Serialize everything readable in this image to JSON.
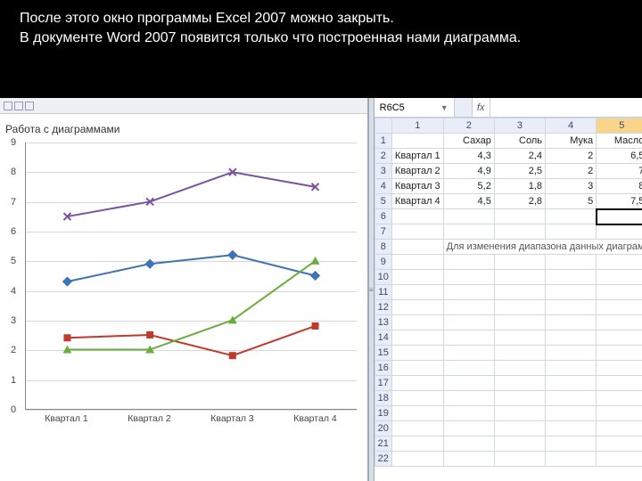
{
  "caption": {
    "line1": "После этого окно программы Excel 2007 можно закрыть.",
    "line2": "В документе Word 2007 появится только что построенная нами диаграмма."
  },
  "word": {
    "chart_tools_label": "Работа с диаграммами"
  },
  "excel": {
    "namebox": "R6C5",
    "fx_label": "fx",
    "columns": [
      "1",
      "2",
      "3",
      "4",
      "5"
    ],
    "selected_col_index": 4,
    "headers_row": [
      "",
      "Сахар",
      "Соль",
      "Мука",
      "Масло"
    ],
    "data_rows": [
      [
        "Квартал 1",
        "4,3",
        "2,4",
        "2",
        "6,5"
      ],
      [
        "Квартал 2",
        "4,9",
        "2,5",
        "2",
        "7"
      ],
      [
        "Квартал 3",
        "5,2",
        "1,8",
        "3",
        "8"
      ],
      [
        "Квартал 4",
        "4,5",
        "2,8",
        "5",
        "7,5"
      ]
    ],
    "active_cell": {
      "r": 6,
      "c": 5
    },
    "hint_text": "Для изменения диапазона данных диаграм",
    "blank_rows_start": 6,
    "blank_rows_end": 22
  },
  "chart_data": {
    "type": "line",
    "categories": [
      "Квартал 1",
      "Квартал 2",
      "Квартал 3",
      "Квартал 4"
    ],
    "series": [
      {
        "name": "Сахар",
        "color": "#3f73b8",
        "values": [
          4.3,
          4.9,
          5.2,
          4.5
        ]
      },
      {
        "name": "Соль",
        "color": "#c0392b",
        "values": [
          2.4,
          2.5,
          1.8,
          2.8
        ]
      },
      {
        "name": "Мука",
        "color": "#6bac3f",
        "values": [
          2.0,
          2.0,
          3.0,
          5.0
        ]
      },
      {
        "name": "Масло",
        "color": "#7a52a0",
        "values": [
          6.5,
          7.0,
          8.0,
          7.5
        ]
      }
    ],
    "ylim": [
      0,
      9
    ],
    "yticks": [
      0,
      1,
      2,
      3,
      4,
      5,
      6,
      7,
      8,
      9
    ],
    "xlabel": "",
    "ylabel": "",
    "title": ""
  }
}
